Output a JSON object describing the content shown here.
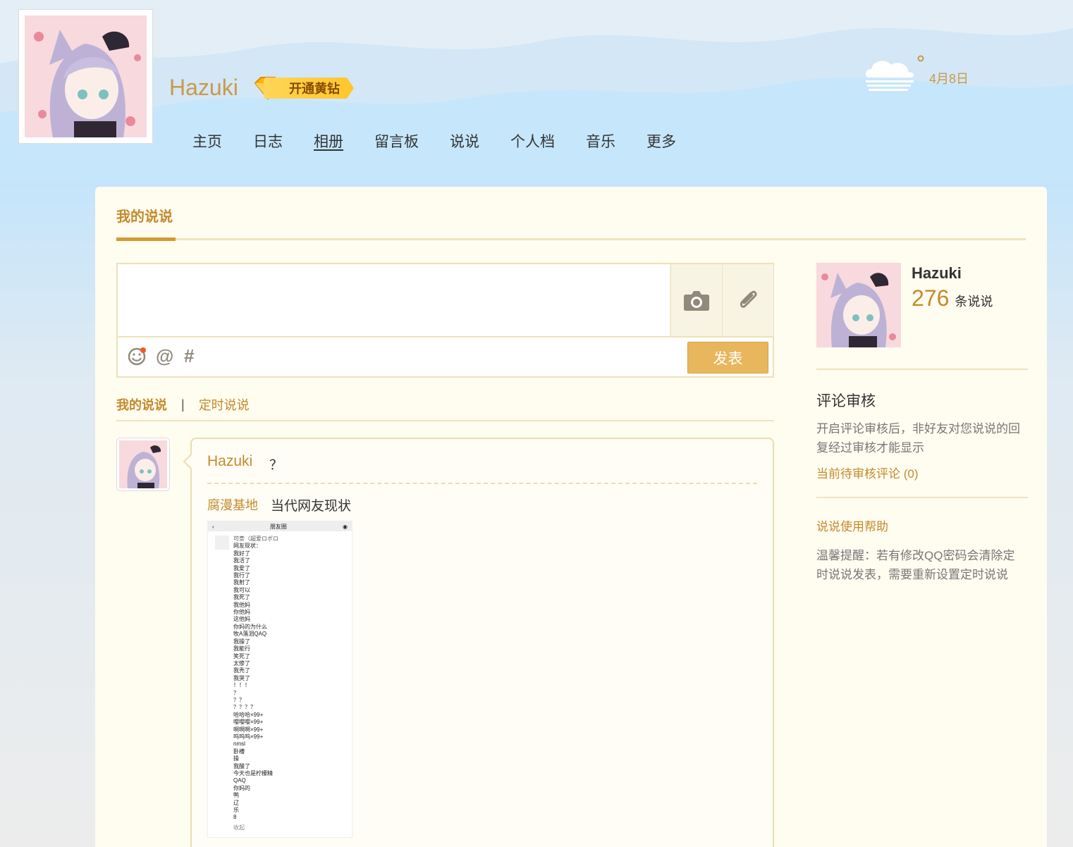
{
  "header": {
    "username": "Hazuki",
    "vip_label": "开通黄钻",
    "weather_date": "4月8日"
  },
  "nav": {
    "items": [
      {
        "label": "主页"
      },
      {
        "label": "日志"
      },
      {
        "label": "相册",
        "active": true
      },
      {
        "label": "留言板"
      },
      {
        "label": "说说"
      },
      {
        "label": "个人档"
      },
      {
        "label": "音乐"
      },
      {
        "label": "更多"
      }
    ]
  },
  "main": {
    "title": "我的说说",
    "post_button": "发表",
    "tabs": {
      "mine": "我的说说",
      "separator": "|",
      "scheduled": "定时说说"
    },
    "feed": {
      "user": "Hazuki",
      "text": "？",
      "source": "腐漫基地",
      "share_title": "当代网友现状",
      "screenshot": {
        "header": "朋友圈",
        "name": "可柰（超爱ロボロ",
        "lines": [
          "网友现状：",
          "我好了",
          "我活了",
          "我爱了",
          "我行了",
          "我射了",
          "我可以",
          "我死了",
          "我他妈",
          "你他妈",
          "这他妈",
          "你妈的为什么",
          "牧A落泪QAQ",
          "我操了",
          "我能行",
          "笑死了",
          "太惨了",
          "我秃了",
          "我哭了",
          "！！！",
          "？",
          "？？",
          "？？？？",
          "哈哈哈×99+",
          "嘤嘤嘤×99+",
          "啊啊啊×99+",
          "呜呜呜×99+",
          "nmsl",
          "卧槽",
          "操",
          "我酸了",
          "今天也是柠檬精",
          "QAQ",
          "你妈的",
          "鸭",
          "辽",
          "乐",
          "8"
        ],
        "collapse": "收起"
      }
    }
  },
  "sidebar": {
    "name": "Hazuki",
    "count": "276",
    "count_unit": "条说说",
    "review_title": "评论审核",
    "review_desc": "开启评论审核后，非好友对您说说的回复经过审核才能显示",
    "pending_link": "当前待审核评论 (0)",
    "help_link": "说说使用帮助",
    "tip": "温馨提醒：若有修改QQ密码会清除定时说说发表，需要重新设置定时说说"
  },
  "icons": {
    "camera": "camera-icon",
    "attach": "paperclip-icon",
    "emoji": "smiley-icon",
    "at": "at-icon",
    "hashtag": "hashtag-icon",
    "weather": "cloud-fog-icon",
    "vip": "diamond-icon"
  },
  "colors": {
    "accent": "#c48a2c",
    "post_button": "#e8b65c",
    "card_bg": "#fffcf0"
  }
}
